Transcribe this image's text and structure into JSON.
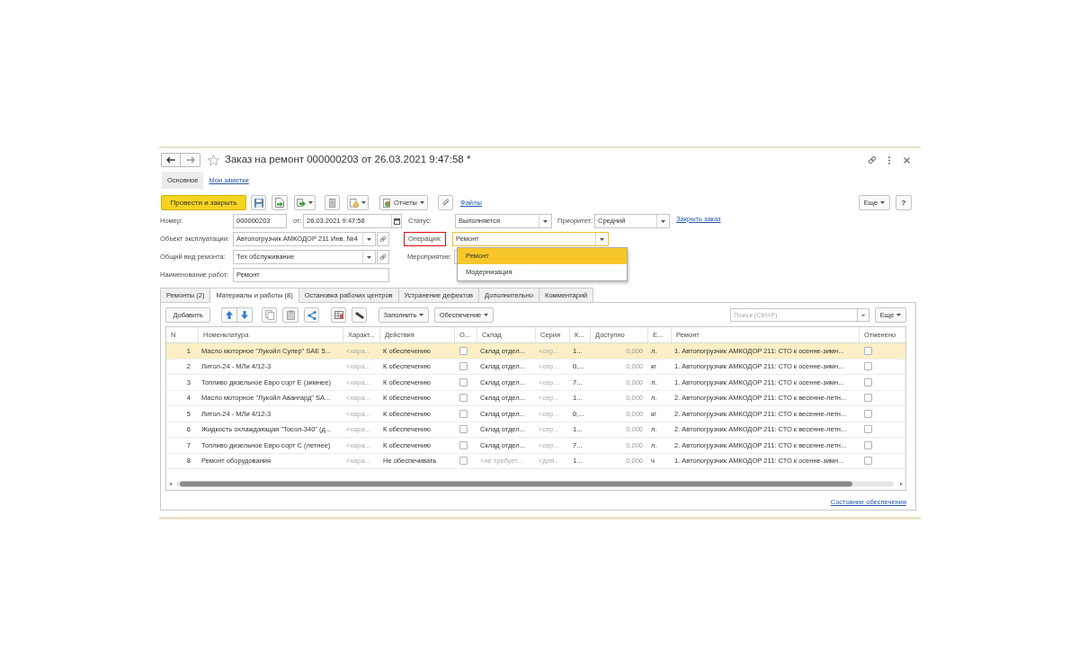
{
  "window": {
    "title": "Заказ на ремонт 000000203 от 26.03.2021 9:47:58 *",
    "favorite": false
  },
  "form_tabs": [
    {
      "label": "Основное",
      "selected": true
    },
    {
      "label": "Мои заметки",
      "selected": false
    }
  ],
  "toolbar": {
    "post_and_close": "Провести и закрыть",
    "reports": "Отчеты",
    "files": "Файлы",
    "more": "Еще",
    "help": "?"
  },
  "header_fields": {
    "number": {
      "label": "Номер:",
      "value": "000000203"
    },
    "date": {
      "label": "от:",
      "value": "26.03.2021 9:47:58"
    },
    "status": {
      "label": "Статус:",
      "value": "Выполняется"
    },
    "priority": {
      "label": "Приоритет:",
      "value": "Средний"
    },
    "close_order": "Закрыть заказ",
    "object": {
      "label": "Объект эксплуатации:",
      "value": "Автопогрузчик АМКОДОР 211 Инв. №4"
    },
    "operation": {
      "label": "Операция:",
      "value": "Ремонт",
      "focused": true,
      "highlighted": true,
      "options": [
        {
          "label": "Ремонт",
          "selected": true
        },
        {
          "label": "Модернизация",
          "selected": false
        }
      ]
    },
    "repair_type": {
      "label": "Общий вид ремонта:",
      "value": "Тех обслуживание"
    },
    "event": {
      "label": "Мероприятие:"
    },
    "work_name": {
      "label": "Наименование работ:",
      "value": "Ремонт"
    }
  },
  "tabs": [
    {
      "label": "Ремонты (2)",
      "selected": false
    },
    {
      "label": "Материалы и работы (8)",
      "selected": true
    },
    {
      "label": "Остановка рабочих центров",
      "selected": false
    },
    {
      "label": "Устранение дефектов",
      "selected": false
    },
    {
      "label": "Дополнительно",
      "selected": false
    },
    {
      "label": "Комментарий",
      "selected": false
    }
  ],
  "table_toolbar": {
    "add": "Добавить",
    "fill": "Заполнить",
    "supply": "Обеспечение",
    "search": {
      "placeholder": "Поиск (Ctrl+F)"
    },
    "clear": "×",
    "more": "Еще"
  },
  "table": {
    "columns": [
      {
        "label": "N",
        "kind": "index"
      },
      {
        "label": "Номенклатура",
        "kind": "text"
      },
      {
        "label": "Характ...",
        "kind": "text"
      },
      {
        "label": "Действия",
        "kind": "text"
      },
      {
        "label": "О...",
        "kind": "checkbox"
      },
      {
        "label": "Склад",
        "kind": "text"
      },
      {
        "label": "Серия",
        "kind": "text"
      },
      {
        "label": "К...",
        "kind": "text"
      },
      {
        "label": "Доступно",
        "kind": "readonly"
      },
      {
        "label": "Е...",
        "kind": "text"
      },
      {
        "label": "Ремонт",
        "kind": "text"
      },
      {
        "label": "Отменено",
        "kind": "checkbox"
      }
    ],
    "rows": [
      {
        "selected": true,
        "cells": [
          "1",
          "Масло моторное \"Лукойл Супер\" SAE 5...",
          {
            "placeholder": "<хара..."
          },
          "К обеспечению",
          {
            "checked": false
          },
          "Склад отдел...",
          {
            "placeholder": "<сер..."
          },
          "1...",
          "0,000",
          "л.",
          "1. Автопогрузчик АМКОДОР 211: СТО к осенне-зимн...",
          {
            "checked": false
          }
        ]
      },
      {
        "selected": false,
        "cells": [
          "2",
          "Литол-24 - МЛи 4/12-3",
          {
            "placeholder": "<хара..."
          },
          "К обеспечению",
          {
            "checked": false
          },
          "Склад отдел...",
          {
            "placeholder": "<сер..."
          },
          "0,...",
          "0,000",
          "кг",
          "1. Автопогрузчик АМКОДОР 211: СТО к осенне-зимн...",
          {
            "checked": false
          }
        ]
      },
      {
        "selected": false,
        "cells": [
          "3",
          "Топливо дизельное Евро сорт Е (зимнее)",
          {
            "placeholder": "<хара..."
          },
          "К обеспечению",
          {
            "checked": false
          },
          "Склад отдел...",
          {
            "placeholder": "<сер..."
          },
          "7...",
          "0,000",
          "л.",
          "1. Автопогрузчик АМКОДОР 211: СТО к осенне-зимн...",
          {
            "checked": false
          }
        ]
      },
      {
        "selected": false,
        "cells": [
          "4",
          "Масло моторное \"Лукойл Авангард\" SA...",
          {
            "placeholder": "<хара..."
          },
          "К обеспечению",
          {
            "checked": false
          },
          "Склад отдел...",
          {
            "placeholder": "<сер..."
          },
          "1...",
          "0,000",
          "л.",
          "2. Автопогрузчик АМКОДОР 211: СТО к весенне-летн...",
          {
            "checked": false
          }
        ]
      },
      {
        "selected": false,
        "cells": [
          "5",
          "Литол-24 - МЛи 4/12-3",
          {
            "placeholder": "<хара..."
          },
          "К обеспечению",
          {
            "checked": false
          },
          "Склад отдел...",
          {
            "placeholder": "<сер..."
          },
          "0,...",
          "0,000",
          "кг",
          "2. Автопогрузчик АМКОДОР 211: СТО к весенне-летн...",
          {
            "checked": false
          }
        ]
      },
      {
        "selected": false,
        "cells": [
          "6",
          "Жидкость охлаждающая \"Тосол-340\" (д...",
          {
            "placeholder": "<хара..."
          },
          "К обеспечению",
          {
            "checked": false
          },
          "Склад отдел...",
          {
            "placeholder": "<сер..."
          },
          "1...",
          "0,000",
          "л.",
          "2. Автопогрузчик АМКОДОР 211: СТО к весенне-летн...",
          {
            "checked": false
          }
        ]
      },
      {
        "selected": false,
        "cells": [
          "7",
          "Топливо дизельное Евро сорт С (летнее)",
          {
            "placeholder": "<хара..."
          },
          "К обеспечению",
          {
            "checked": false
          },
          "Склад отдел...",
          {
            "placeholder": "<сер..."
          },
          "7...",
          "0,000",
          "л.",
          "2. Автопогрузчик АМКОДОР 211: СТО к весенне-летн...",
          {
            "checked": false
          }
        ]
      },
      {
        "selected": false,
        "cells": [
          "8",
          "Ремонт оборудования",
          {
            "placeholder": "<хара..."
          },
          "Не обеспечивать",
          {
            "checked": false
          },
          {
            "placeholder": "<не требует..."
          },
          {
            "placeholder": "<для..."
          },
          "1...",
          "0,000",
          "ч",
          "1. Автопогрузчик АМКОДОР 211: СТО к осенне-зимн...",
          {
            "checked": false
          }
        ]
      }
    ]
  },
  "supply_status_link": "Состояние обеспечения"
}
